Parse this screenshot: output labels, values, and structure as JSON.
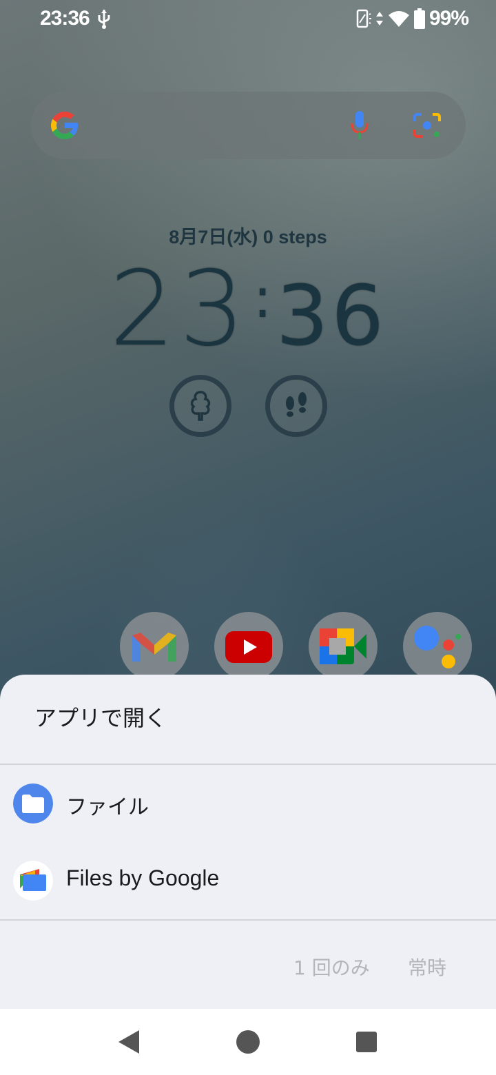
{
  "status_bar": {
    "time": "23:36",
    "battery": "99%",
    "icons": [
      "usb-icon",
      "screen-rotate-icon",
      "data-arrows-icon",
      "wifi-icon",
      "battery-icon"
    ]
  },
  "search_bar": {
    "icons": [
      "google-g-icon",
      "mic-icon",
      "lens-icon"
    ]
  },
  "lock_widget": {
    "date_line": "8月7日(水)   0 steps",
    "clock_hours": "23",
    "clock_minutes": "36"
  },
  "dock": {
    "icons": [
      "gmail-icon",
      "youtube-icon",
      "meet-icon",
      "assistant-icon"
    ]
  },
  "sheet": {
    "title": "アプリで開く",
    "apps": [
      {
        "label": "ファイル",
        "icon": "folder-icon"
      },
      {
        "label": "Files by Google",
        "icon": "files-by-google-icon"
      }
    ],
    "just_once": "1 回のみ",
    "always": "常時"
  },
  "colors": {
    "sheet_bg": "#eef0f5",
    "folder_blue": "#4f86ec",
    "disabled_text": "#b3b5ba"
  }
}
